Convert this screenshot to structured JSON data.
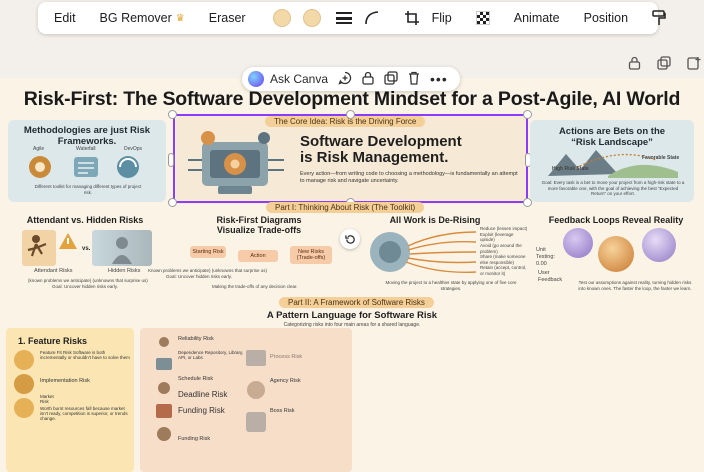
{
  "toolbar": {
    "edit": "Edit",
    "bg_remover": "BG Remover",
    "eraser": "Eraser",
    "flip": "Flip",
    "animate": "Animate",
    "position": "Position",
    "swatch_colors": [
      "#f4d9a8",
      "#f4d9a8"
    ]
  },
  "context_bar": {
    "ask_canva": "Ask Canva"
  },
  "design": {
    "title": "Risk-First: The Software Development Mindset for a Post-Agile, AI World",
    "row1": {
      "left": {
        "heading": "Methodologies are just Risk Frameworks.",
        "labels": [
          "Agile",
          "Waterfall",
          "DevOps"
        ],
        "caption": "Different toolkit for managing different types of project risk."
      },
      "center": {
        "banner": "The Core Idea: Risk is the Driving Force",
        "heading_line1": "Software Development",
        "heading_line2": "is Risk Management.",
        "desc": "Every action—from writing code to choosing a methodology—is fundamentally an attempt to manage risk and navigate uncertainty."
      },
      "right": {
        "heading": "Actions are Bets on the “Risk Landscape”",
        "labels": [
          "High Risk State",
          "Favorable State"
        ],
        "caption": "Goal: Every task is a bet to move your project from a high-risk state to a more favorable one, with the goal of achieving the best “Expected Return” on your effort."
      }
    },
    "part1": {
      "banner": "Part I: Thinking About Risk (The Toolkit)",
      "attendant": {
        "title": "Attendant vs. Hidden Risks",
        "vs": "vs.",
        "label_attendant": "Attendant Risks",
        "label_hidden": "Hidden Risks",
        "note1": "(known problems we anticipate) (unknowns that surprise us)",
        "note2": "Goal: Uncover hidden risks early."
      },
      "diagrams": {
        "title_line1": "Risk-First Diagrams",
        "title_line2": "Visualize Trade-offs",
        "tags": [
          "Starting Risk",
          "Action",
          "New Risks (Trade-offs)"
        ],
        "note1": "Known problems we anticipate) (unknowns that surprise us)",
        "note2": "Goal: Uncover hidden risks early.",
        "note3": "Making the trade-offs of any decision clear."
      },
      "derisking": {
        "title": "All Work is De-Rising",
        "items": [
          "Reduce (lessen impact)",
          "Exploit (leverage upside)",
          "Avoid (go around the problem)",
          "Share (make someone else responsible)",
          "Retain (accept, control, or monitor it)"
        ],
        "caption": "Moving the project to a healthier state by applying one of five core strategies."
      },
      "feedback": {
        "title": "Feedback Loops Reveal Reality",
        "labels": [
          "Unit Testing: 0.00",
          "User Feedback"
        ],
        "caption": "Test our assumptions against reality, turning hidden risks into known ones. The faster the loop, the faster we learn."
      }
    },
    "part2": {
      "banner": "Part II: A Framework of Software Risks",
      "title": "A Pattern Language for Software Risk",
      "subtitle": "Categorizing risks into four main areas for a shared language.",
      "feature": {
        "title": "1. Feature Risks",
        "items": [
          "Feature Fit Risk\nSoftware is both incrementally or shouldn't have to solve them",
          "Implementation Risk",
          "Market Risk",
          "Worth burnt resources fall because market isn't ready, competition is superior, or trends change."
        ]
      },
      "middle": {
        "items": [
          "Reliability Risk",
          "Dependence Repository, Library, API, or Labs",
          "Schedule Risk",
          "Deadline Risk",
          "Funding Risk",
          "Funding Risk"
        ],
        "right_items": [
          "Process Risk",
          "Agency Risk",
          "Boss Risk"
        ]
      }
    }
  }
}
